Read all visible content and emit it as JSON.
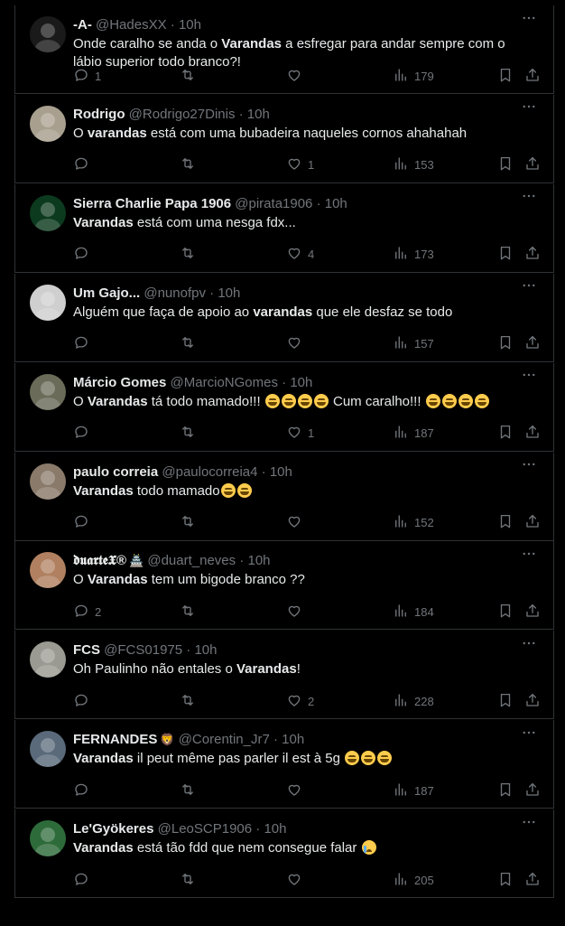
{
  "tweets": [
    {
      "name": "-A-",
      "handle": "@HadesXX",
      "time": "10h",
      "text_html": "Onde caralho se anda o <b>Varandas</b> a esfregar para andar sempre com o lábio superior todo branco?!",
      "replies": "1",
      "retweets": "",
      "likes": "",
      "views": "179",
      "avatar_color": "#1a1a1a"
    },
    {
      "name": "Rodrigo",
      "handle": "@Rodrigo27Dinis",
      "time": "10h",
      "text_html": "O <b>varandas</b> está com uma bubadeira naqueles cornos ahahahah",
      "replies": "",
      "retweets": "",
      "likes": "1",
      "views": "153",
      "avatar_color": "#a89f8e"
    },
    {
      "name": "Sierra Charlie Papa 1906",
      "handle": "@pirata1906",
      "time": "10h",
      "text_html": "<b>Varandas</b> está com uma nesga fdx...",
      "replies": "",
      "retweets": "",
      "likes": "4",
      "views": "173",
      "avatar_color": "#0c3a1e"
    },
    {
      "name": "Um Gajo...",
      "handle": "@nunofpv",
      "time": "10h",
      "text_html": "Alguém que faça de apoio ao <b>varandas</b> que ele desfaz se todo",
      "replies": "",
      "retweets": "",
      "likes": "",
      "views": "157",
      "avatar_color": "#cfcfcf"
    },
    {
      "name": "Márcio Gomes",
      "handle": "@MarcioNGomes",
      "time": "10h",
      "text_html": "O <b>Varandas</b> tá todo mamado!!! <span class=\"emo\"></span><span class=\"emo\"></span><span class=\"emo\"></span><span class=\"emo\"></span> Cum caralho!!! <span class=\"emo\"></span><span class=\"emo\"></span><span class=\"emo\"></span><span class=\"emo\"></span>",
      "replies": "",
      "retweets": "",
      "likes": "1",
      "views": "187",
      "avatar_color": "#6b6b5a"
    },
    {
      "name": "paulo correia",
      "handle": "@paulocorreia4",
      "time": "10h",
      "text_html": "<b>Varandas</b> todo mamado<span class=\"emo\"></span><span class=\"emo\"></span>",
      "replies": "",
      "retweets": "",
      "likes": "",
      "views": "152",
      "avatar_color": "#8a7a6a"
    },
    {
      "name": "𝖉𝖚𝖆𝖗𝖙𝖊𝖃®",
      "badge": "🏯",
      "handle": "@duart_neves",
      "time": "10h",
      "text_html": "O <b>Varandas</b> tem um bigode branco ??",
      "replies": "2",
      "retweets": "",
      "likes": "",
      "views": "184",
      "avatar_color": "#b08060"
    },
    {
      "name": "FCS",
      "handle": "@FCS01975",
      "time": "10h",
      "text_html": "Oh Paulinho não entales o <b>Varandas</b>!",
      "replies": "",
      "retweets": "",
      "likes": "2",
      "views": "228",
      "avatar_color": "#9a9a92"
    },
    {
      "name": "FERNANDES",
      "badge": "🦁",
      "handle": "@Corentin_Jr7",
      "time": "10h",
      "text_html": "<b>Varandas</b> il peut même pas parler il est à 5g <span class=\"emo\"></span><span class=\"emo\"></span><span class=\"emo\"></span>",
      "replies": "",
      "retweets": "",
      "likes": "",
      "views": "187",
      "avatar_color": "#5a6a7a"
    },
    {
      "name": "Le'Gyökeres",
      "handle": "@LeoSCP1906",
      "time": "10h",
      "text_html": "<b>Varandas</b> está tão fdd que nem consegue falar <span class=\"emo cry\"></span>",
      "replies": "",
      "retweets": "",
      "likes": "",
      "views": "205",
      "avatar_color": "#2e6b3a"
    }
  ],
  "dot": "·",
  "colors": {
    "bg": "#000000",
    "text": "#e7e9ea",
    "muted": "#71767b",
    "border": "#2f3336"
  },
  "icons": {
    "reply": "reply-icon",
    "retweet": "retweet-icon",
    "like": "heart-icon",
    "views": "views-icon",
    "bookmark": "bookmark-icon",
    "share": "share-icon",
    "more": "more-dots-icon"
  }
}
